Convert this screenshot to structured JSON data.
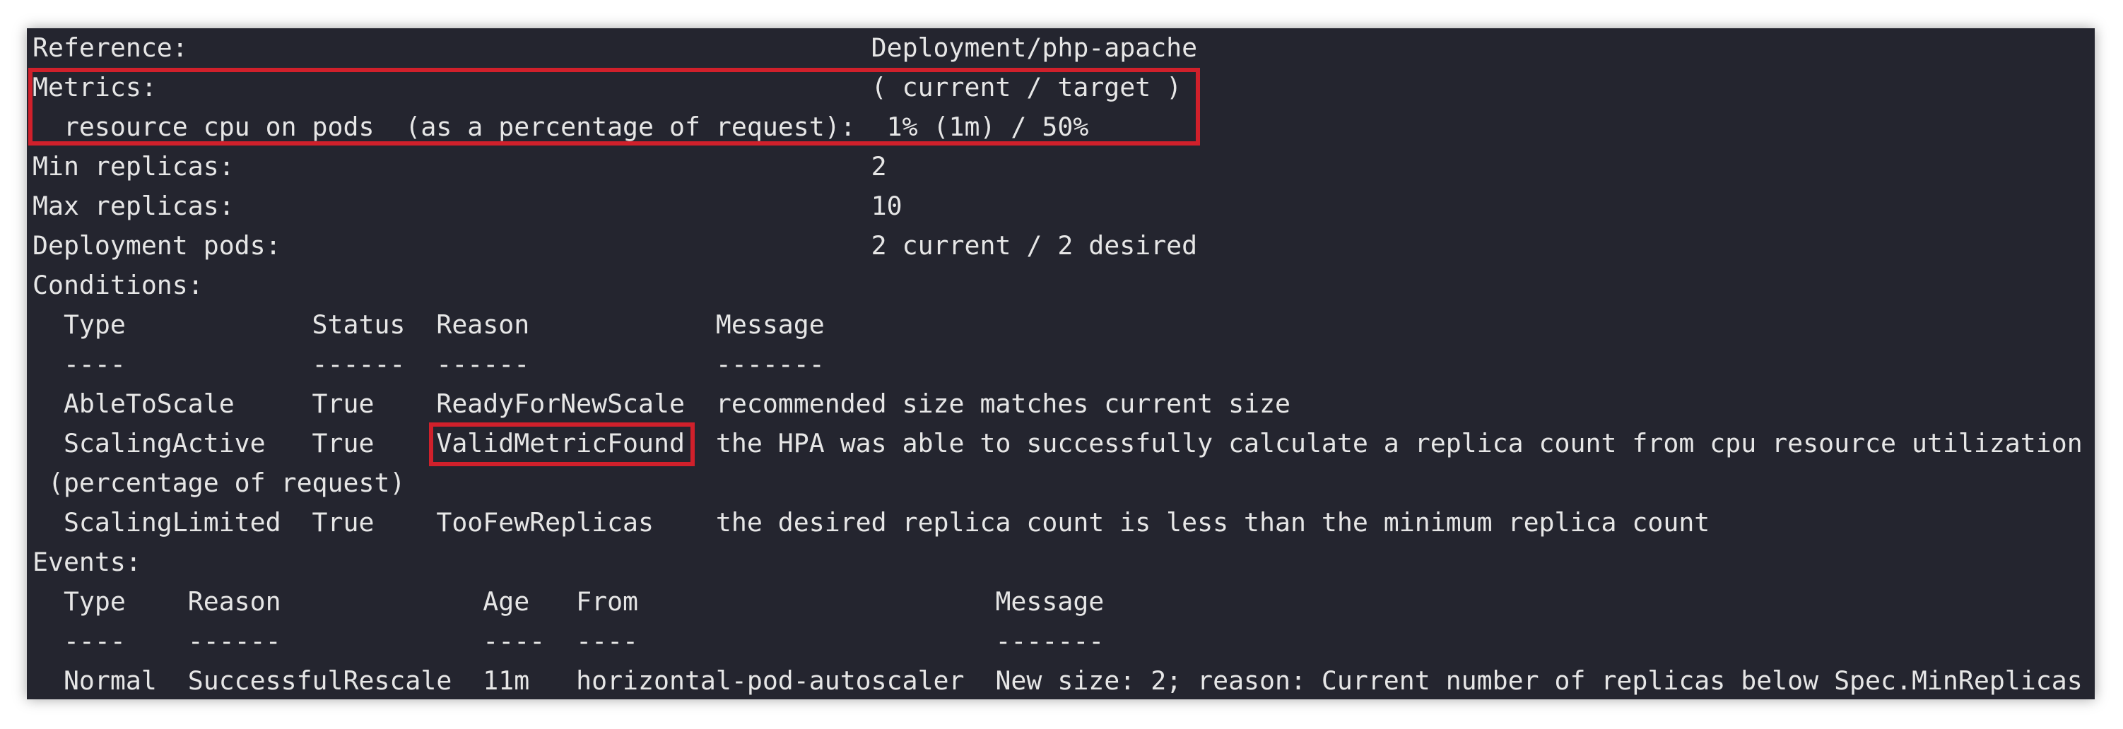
{
  "terminal": {
    "lines": [
      "Reference:                                            Deployment/php-apache",
      "Metrics:                                              ( current / target )",
      "  resource cpu on pods  (as a percentage of request):  1% (1m) / 50%",
      "Min replicas:                                         2",
      "Max replicas:                                         10",
      "Deployment pods:                                      2 current / 2 desired",
      "Conditions:",
      "  Type            Status  Reason            Message",
      "  ----            ------  ------            -------",
      "  AbleToScale     True    ReadyForNewScale  recommended size matches current size",
      "  ScalingActive   True    ValidMetricFound  the HPA was able to successfully calculate a replica count from cpu resource utilization",
      " (percentage of request)",
      "  ScalingLimited  True    TooFewReplicas    the desired replica count is less than the minimum replica count",
      "Events:",
      "  Type    Reason             Age   From                       Message",
      "  ----    ------             ----  ----                       -------",
      "  Normal  SuccessfulRescale  11m   horizontal-pod-autoscaler  New size: 2; reason: Current number of replicas below Spec.MinReplicas"
    ]
  },
  "colors": {
    "background": "#24252f",
    "text": "#e6e6e6",
    "highlight": "#d0202b"
  }
}
